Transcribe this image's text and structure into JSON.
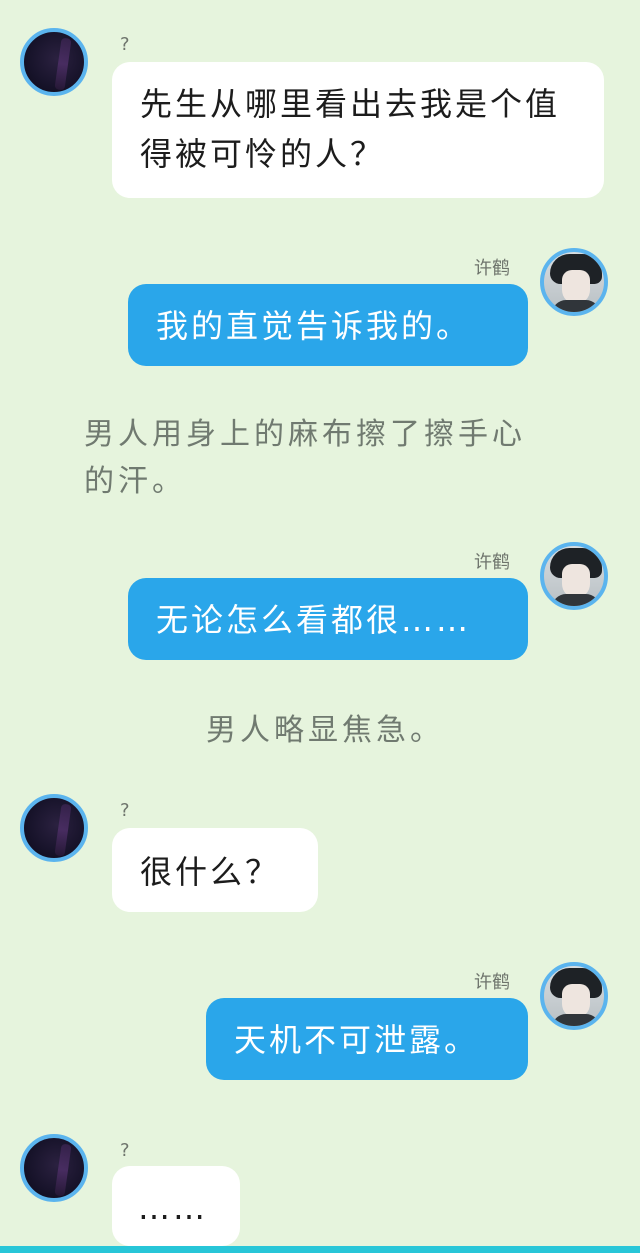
{
  "messages": [
    {
      "sender": "?",
      "text": "先生从哪里看出去我是个值得被可怜的人？"
    },
    {
      "sender": "许鹤",
      "text": "我的直觉告诉我的。"
    },
    {
      "narration": "男人用身上的麻布擦了擦手心的汗。"
    },
    {
      "sender": "许鹤",
      "text": "无论怎么看都很……"
    },
    {
      "narration": "男人略显焦急。"
    },
    {
      "sender": "?",
      "text": "很什么？"
    },
    {
      "sender": "许鹤",
      "text": "天机不可泄露。"
    },
    {
      "sender": "?",
      "text": "……"
    }
  ],
  "icons": {
    "left_avatar": "dark-figure-avatar",
    "right_avatar": "boy-portrait-avatar"
  },
  "colors": {
    "background": "#e6f4dd",
    "blue_bubble": "#2aa6ea",
    "white_bubble": "#ffffff",
    "avatar_ring": "#5bb4ee",
    "bottom_bar": "#28c6d8"
  }
}
